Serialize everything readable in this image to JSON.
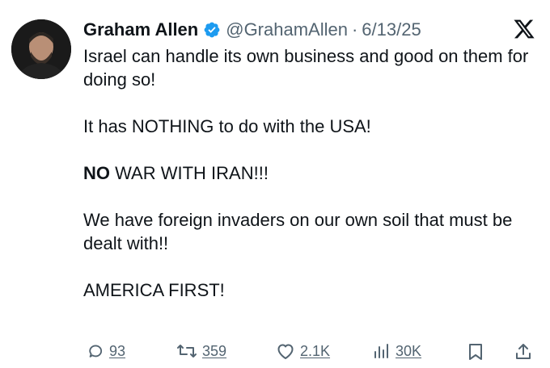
{
  "tweet": {
    "author_name": "Graham Allen",
    "handle": "@GrahamAllen",
    "separator": "·",
    "date": "6/13/25",
    "paragraphs": [
      "Israel can handle its own business and good on them for doing so!",
      "It has NOTHING to do with the USA!",
      {
        "bold": "NO",
        "rest": " WAR WITH IRAN!!!"
      },
      "We have foreign invaders on our own soil that must be dealt with!!",
      "AMERICA FIRST!"
    ]
  },
  "actions": {
    "replies": "93",
    "reposts": "359",
    "likes": "2.1K",
    "views": "30K"
  },
  "icons": {
    "verified": "verified-badge-icon",
    "platform": "x-logo-icon",
    "reply": "reply-icon",
    "repost": "repost-icon",
    "like": "heart-icon",
    "views": "views-chart-icon",
    "bookmark": "bookmark-icon",
    "share": "share-icon"
  },
  "colors": {
    "text": "#0f1419",
    "secondary": "#536471",
    "verified": "#1d9bf0",
    "background": "#ffffff"
  }
}
